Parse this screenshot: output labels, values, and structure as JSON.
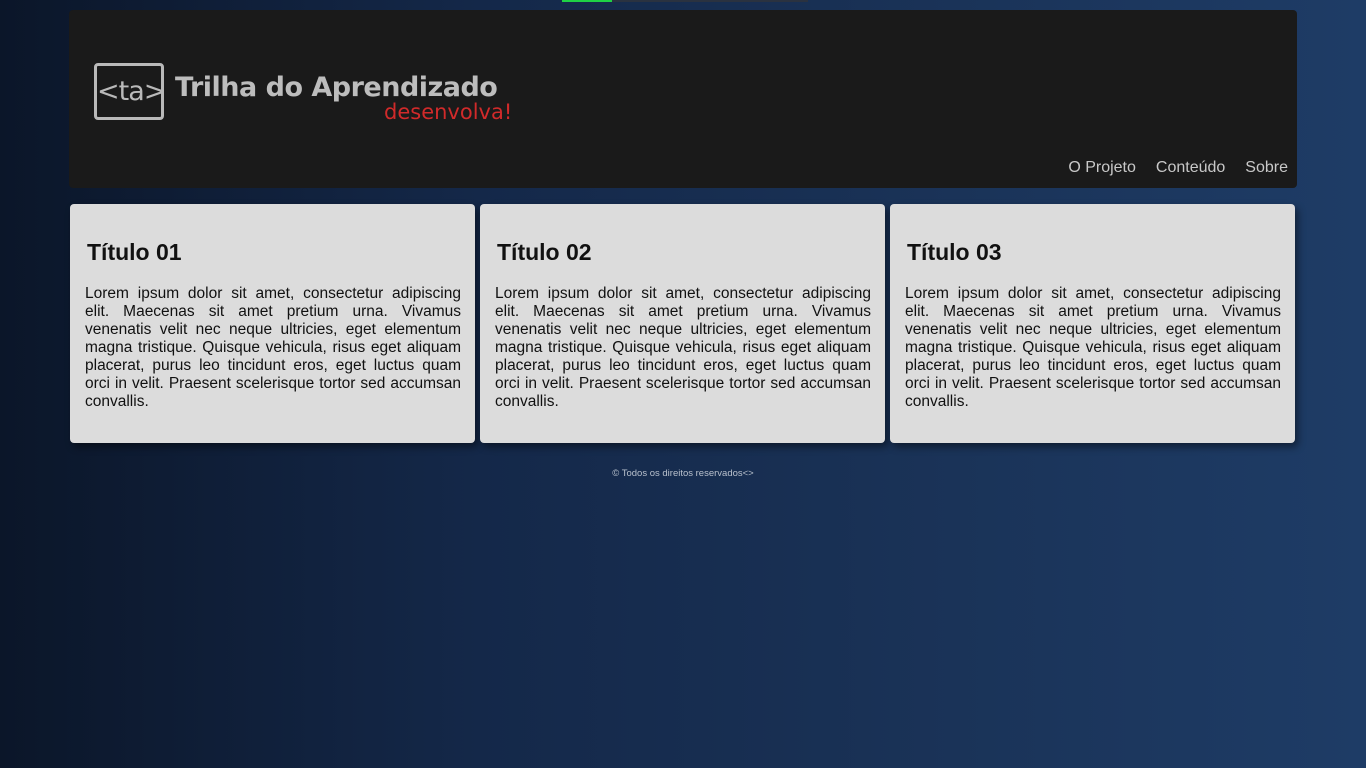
{
  "header": {
    "logo": {
      "mark": "<ta>",
      "title": "Trilha do Aprendizado",
      "subtitle": "desenvolva!"
    },
    "nav": [
      {
        "label": "O Projeto"
      },
      {
        "label": "Conteúdo"
      },
      {
        "label": "Sobre"
      }
    ]
  },
  "cards": [
    {
      "title": "Título 01",
      "text": "Lorem ipsum dolor sit amet, consectetur adipiscing elit. Maecenas sit amet pretium urna. Vivamus venenatis velit nec neque ultricies, eget elementum magna tristique. Quisque vehicula, risus eget aliquam placerat, purus leo tincidunt eros, eget luctus quam orci in velit. Praesent scelerisque tortor sed accumsan convallis."
    },
    {
      "title": "Título 02",
      "text": "Lorem ipsum dolor sit amet, consectetur adipiscing elit. Maecenas sit amet pretium urna. Vivamus venenatis velit nec neque ultricies, eget elementum magna tristique. Quisque vehicula, risus eget aliquam placerat, purus leo tincidunt eros, eget luctus quam orci in velit. Praesent scelerisque tortor sed accumsan convallis."
    },
    {
      "title": "Título 03",
      "text": "Lorem ipsum dolor sit amet, consectetur adipiscing elit. Maecenas sit amet pretium urna. Vivamus venenatis velit nec neque ultricies, eget elementum magna tristique. Quisque vehicula, risus eget aliquam placerat, purus leo tincidunt eros, eget luctus quam orci in velit. Praesent scelerisque tortor sed accumsan convallis."
    }
  ],
  "footer": {
    "text": "© Todos os direitos reservados<>"
  },
  "colors": {
    "header_bg": "#1a1a1a",
    "logo_gray": "#bdbdbd",
    "logo_red": "#d12a2a",
    "card_bg": "#dcdcdc",
    "page_gradient_start": "#0b1629",
    "page_gradient_end": "#1e3c66"
  }
}
